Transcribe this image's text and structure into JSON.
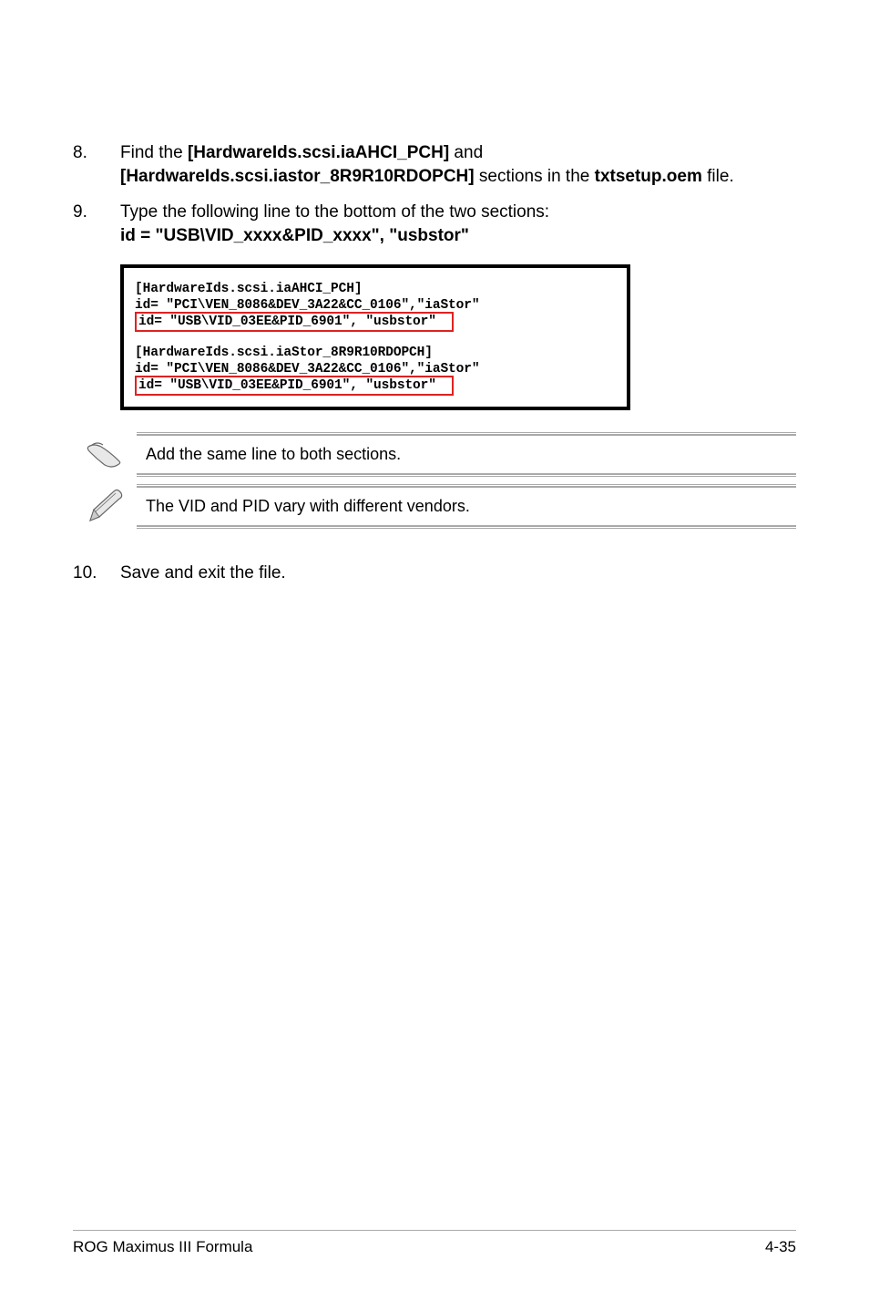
{
  "steps": {
    "s8": {
      "num": "8.",
      "pre": "Find the ",
      "bold1": "[HardwareIds.scsi.iaAHCI_PCH]",
      "mid": " and ",
      "bold2": "[HardwareIds.scsi.iastor_8R9R10RDOPCH]",
      "post1": " sections in the ",
      "bold3": "txtsetup.oem",
      "post2": " file."
    },
    "s9": {
      "num": "9.",
      "line1": "Type the following line to the bottom of the two sections:",
      "line2": "id = \"USB\\VID_xxxx&PID_xxxx\", \"usbstor\""
    },
    "s10": {
      "num": "10.",
      "text": "Save and exit the file."
    }
  },
  "code": {
    "l1": "[HardwareIds.scsi.iaAHCI_PCH]",
    "l2": "id= \"PCI\\VEN_8086&DEV_3A22&CC_0106\",\"iaStor\"",
    "l3": "id= \"USB\\VID_03EE&PID_6901\", \"usbstor\"",
    "l4": "[HardwareIds.scsi.iaStor_8R9R10RDOPCH]",
    "l5": "id= \"PCI\\VEN_8086&DEV_3A22&CC_0106\",\"iaStor\"",
    "l6": "id= \"USB\\VID_03EE&PID_6901\", \"usbstor\""
  },
  "notes": {
    "n1": "Add the same line to both sections.",
    "n2": "The VID and PID vary with different vendors."
  },
  "footer": {
    "left": "ROG Maximus III Formula",
    "right": "4-35"
  }
}
